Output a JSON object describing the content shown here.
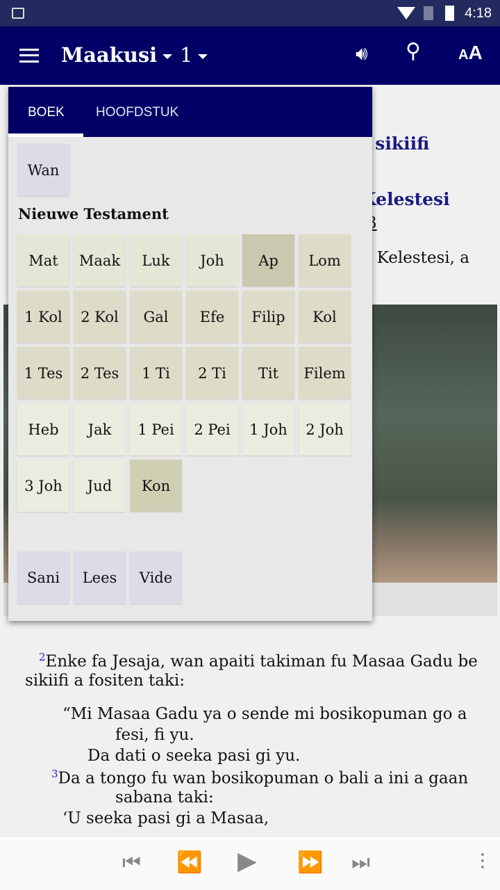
{
  "status": {
    "time": "4:18"
  },
  "appbar": {
    "book": "Maakusi",
    "chapter": "1"
  },
  "content": {
    "heading1": "si sikiifi",
    "heading2": "Kelestesi",
    "ref": "3",
    "line1": "i Kelestesi, a",
    "verse2_num": "2",
    "verse2_l1": "Enke fa Jesaja, wan apaiti takiman fu Masaa Gadu be",
    "verse2_l2": "sikiifi a fositen taki:",
    "q1": "“Mi Masaa Gadu ya o sende mi bosikopuman go a",
    "q2": "fesi, fi yu.",
    "q3": "Da dati o seeka pasi gi yu.",
    "verse3_num": "3",
    "q4": "Da a tongo fu wan bosikopuman o bali a ini a gaan",
    "q5": "sabana taki:",
    "q6": "‘U seeka pasi gi a Masaa,"
  },
  "popup": {
    "tabs": [
      "BOEK",
      "HOOFDSTUK"
    ],
    "active_tab": "BOEK",
    "top_cells": [
      "Wan"
    ],
    "section": "Nieuwe Testament",
    "books": [
      "Mat",
      "Maak",
      "Luk",
      "Joh",
      "Ap",
      "Lom",
      "1 Kol",
      "2 Kol",
      "Gal",
      "Efe",
      "Filip",
      "Kol",
      "1 Tes",
      "2 Tes",
      "1 Ti",
      "2 Ti",
      "Tit",
      "Filem",
      "Heb",
      "Jak",
      "1 Pei",
      "2 Pei",
      "1 Joh",
      "2 Joh",
      "3 Joh",
      "Jud",
      "Kon"
    ],
    "book_colors": [
      "#e6e6d6",
      "#e6e6d6",
      "#e6e6d6",
      "#e6e6d6",
      "#c9c9b0",
      "#dcdcc8",
      "#dcdcc8",
      "#dcdcc8",
      "#dcdcc8",
      "#dcdcc8",
      "#dcdcc8",
      "#dcdcc8",
      "#dcdcc8",
      "#dcdcc8",
      "#dcdcc8",
      "#dcdcc8",
      "#dcdcc8",
      "#dcdcc8",
      "#ebebe0",
      "#ebebe0",
      "#ebebe0",
      "#ebebe0",
      "#ebebe0",
      "#ebebe0",
      "#ebebe0",
      "#ebebe0",
      "#cfcfb4"
    ],
    "bottom_cells": [
      "Sani",
      "Lees",
      "Vide"
    ]
  },
  "colors": {
    "primary": "#000066",
    "status": "#222a5e",
    "other_cell": "#dcdce8"
  }
}
